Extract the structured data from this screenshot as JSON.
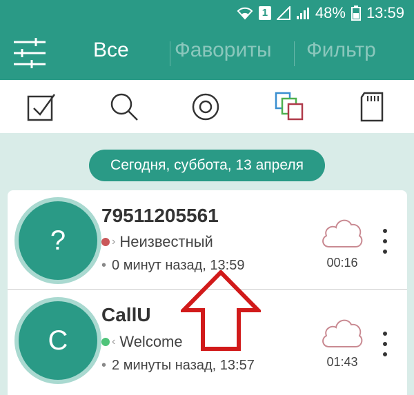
{
  "status_bar": {
    "battery": "48%",
    "clock": "13:59",
    "sim": "1"
  },
  "tabs": [
    {
      "label": "Все",
      "active": true
    },
    {
      "label": "Фавориты",
      "active": false
    },
    {
      "label": "Фильтр",
      "active": false
    }
  ],
  "toolbar": {
    "icons": [
      "checkbox-icon",
      "search-icon",
      "record-icon",
      "copy-icon",
      "sd-card-icon"
    ]
  },
  "date_header": "Сегодня, суббота, 13 апреля",
  "calls": [
    {
      "avatar_letter": "?",
      "name": "79511205561",
      "status": "Неизвестный",
      "status_color": "#c9585a",
      "time": "0 минут назад, 13:59",
      "duration": "00:16"
    },
    {
      "avatar_letter": "C",
      "name": "CallU",
      "status": "Welcome",
      "status_color": "#4fc47a",
      "time": "2 минуты назад, 13:57",
      "duration": "01:43"
    }
  ],
  "colors": {
    "primary": "#2a9a86",
    "background": "#d9ece8",
    "cloud": "#c98a92",
    "annotation_arrow": "#d11a1a"
  }
}
